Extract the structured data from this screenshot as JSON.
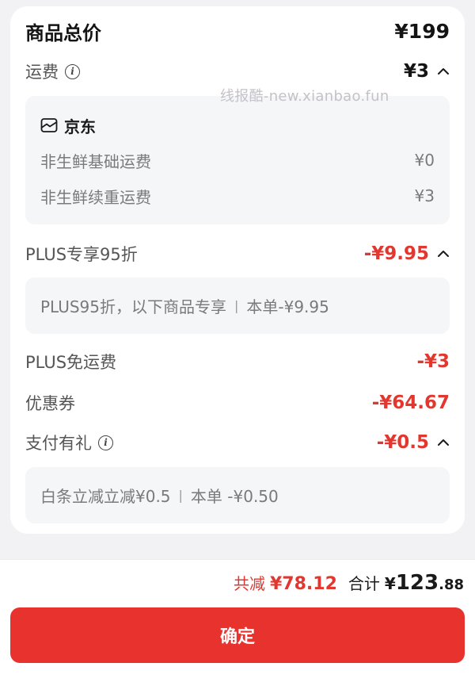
{
  "summary_card": {
    "title": "商品总价",
    "total_price": "¥199",
    "shipping": {
      "label": "运费",
      "amount": "¥3",
      "shop": {
        "name": "京东"
      },
      "lines": [
        {
          "label": "非生鲜基础运费",
          "value": "¥0"
        },
        {
          "label": "非生鲜续重运费",
          "value": "¥3"
        }
      ]
    },
    "plus_discount": {
      "label": "PLUS专享95折",
      "amount": "-¥9.95",
      "detail_left": "PLUS95折，以下商品专享",
      "detail_right": "本单-¥9.95"
    },
    "plus_free_shipping": {
      "label": "PLUS免运费",
      "amount": "-¥3"
    },
    "coupon": {
      "label": "优惠券",
      "amount": "-¥64.67"
    },
    "payment_gift": {
      "label": "支付有礼",
      "amount": "-¥0.5",
      "detail_left": "白条立减立减¥0.5",
      "detail_right": "本单 -¥0.50"
    }
  },
  "watermark": "线报酷-new.xianbao.fun",
  "bottom_bar": {
    "reduce_label": "共减",
    "reduce_value": "¥78.12",
    "total_label": "合计",
    "total_currency": "¥",
    "total_int": "123",
    "total_dec": ".88",
    "confirm_label": "确定"
  },
  "colors": {
    "accent_red": "#e2372f",
    "button_red": "#e8322e",
    "card_bg": "#ffffff",
    "page_bg": "#f2f2f4",
    "detail_box_bg": "#f5f6f8"
  }
}
